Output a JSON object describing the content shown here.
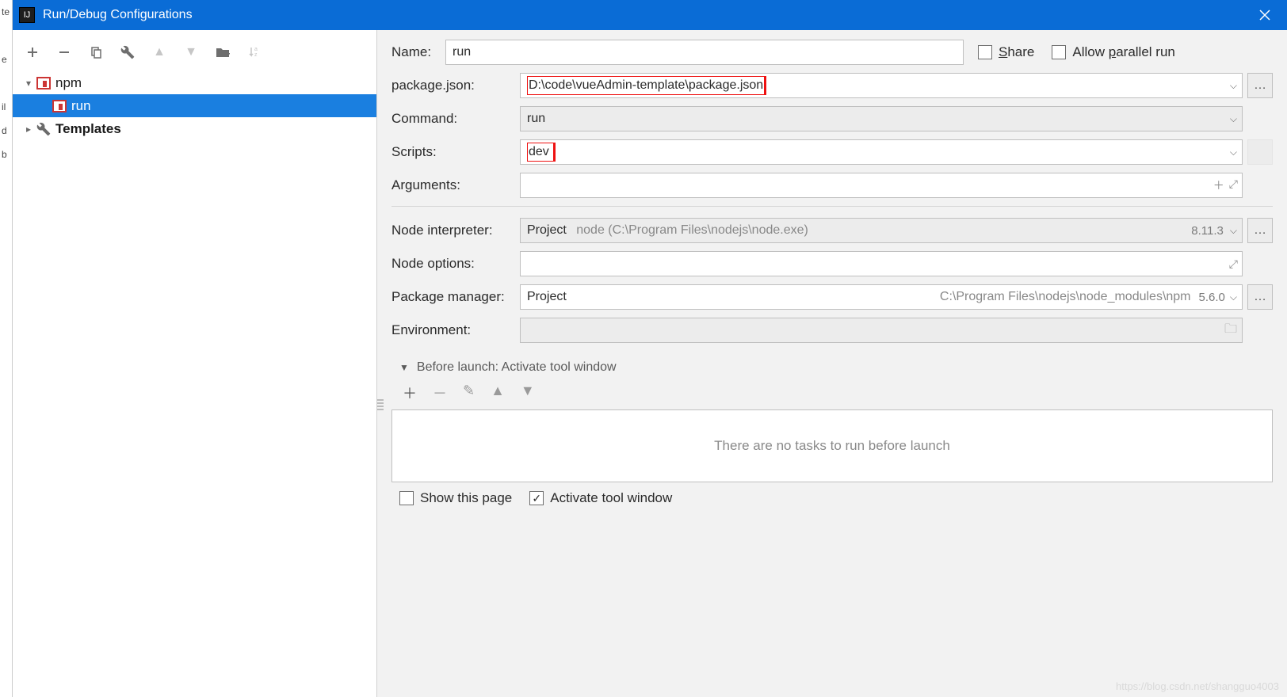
{
  "window": {
    "title": "Run/Debug Configurations"
  },
  "tree": {
    "npm_label": "npm",
    "run_label": "run",
    "templates_label": "Templates"
  },
  "checks_top": {
    "share": "Share",
    "parallel_pre": "Allow ",
    "parallel_u": "p",
    "parallel_post": "arallel run"
  },
  "form": {
    "name_label": "Name:",
    "name_value": "run",
    "package_label": "package.json:",
    "package_value": "D:\\code\\vueAdmin-template\\package.json",
    "command_label": "Command:",
    "command_value": "run",
    "scripts_label": "Scripts:",
    "scripts_value": "dev",
    "arguments_label": "Arguments:",
    "arguments_value": "",
    "node_interp_label": "Node interpreter:",
    "node_interp_proj": "Project",
    "node_interp_path": "node (C:\\Program Files\\nodejs\\node.exe)",
    "node_interp_ver": "8.11.3",
    "node_opts_label": "Node options:",
    "node_opts_value": "",
    "pkg_mgr_label": "Package manager:",
    "pkg_mgr_proj": "Project",
    "pkg_mgr_path": "C:\\Program Files\\nodejs\\node_modules\\npm",
    "pkg_mgr_ver": "5.6.0",
    "env_label": "Environment:"
  },
  "before_launch": {
    "header": "Before launch: Activate tool window",
    "empty": "There are no tasks to run before launch",
    "show_page": "Show this page",
    "activate": "Activate tool window"
  },
  "watermark": "https://blog.csdn.net/shangguo4003"
}
